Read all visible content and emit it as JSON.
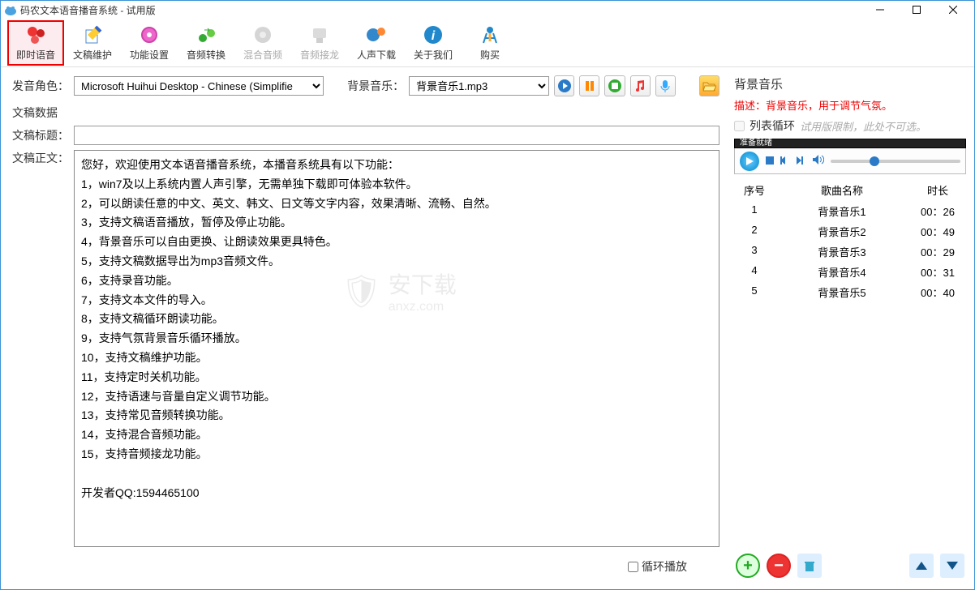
{
  "window": {
    "title": "码农文本语音播音系统 - 试用版"
  },
  "toolbar": {
    "items": [
      {
        "label": "即时语音",
        "icon": "gears-icon",
        "active": true
      },
      {
        "label": "文稿维护",
        "icon": "edit-doc-icon"
      },
      {
        "label": "功能设置",
        "icon": "gear-icon"
      },
      {
        "label": "音频转换",
        "icon": "convert-icon"
      },
      {
        "label": "混合音频",
        "icon": "mix-icon",
        "disabled": true
      },
      {
        "label": "音频接龙",
        "icon": "chain-icon",
        "disabled": true
      },
      {
        "label": "人声下载",
        "icon": "download-icon"
      },
      {
        "label": "关于我们",
        "icon": "info-icon"
      },
      {
        "label": "购买",
        "icon": "buy-icon"
      }
    ]
  },
  "voice": {
    "label": "发音角色：",
    "selected": "Microsoft Huihui Desktop - Chinese (Simplifie"
  },
  "bgm_row": {
    "label": "背景音乐：",
    "selected": "背景音乐1.mp3"
  },
  "data_section": {
    "header": "文稿数据",
    "title_label": "文稿标题：",
    "title_value": "",
    "body_label": "文稿正文：",
    "body_value": "您好，欢迎使用文本语音播音系统，本播音系统具有以下功能：\n1，win7及以上系统内置人声引擎，无需单独下载即可体验本软件。\n2，可以朗读任意的中文、英文、韩文、日文等文字内容，效果清晰、流畅、自然。\n3，支持文稿语音播放，暂停及停止功能。\n4，背景音乐可以自由更换、让朗读效果更具特色。\n5，支持文稿数据导出为mp3音频文件。\n6，支持录音功能。\n7，支持文本文件的导入。\n8，支持文稿循环朗读功能。\n9，支持气氛背景音乐循环播放。\n10，支持文稿维护功能。\n11，支持定时关机功能。\n12，支持语速与音量自定义调节功能。\n13，支持常见音频转换功能。\n14，支持混合音频功能。\n15，支持音频接龙功能。\n\n开发者QQ:1594465100",
    "loop_label": "循环播放"
  },
  "right": {
    "title": "背景音乐",
    "desc": "描述：背景音乐，用于调节气氛。",
    "loop_label": "列表循环",
    "loop_disabled_hint": "试用版限制，此处不可选。",
    "player_status": "准备就绪",
    "columns": {
      "num": "序号",
      "name": "歌曲名称",
      "dur": "时长"
    },
    "tracks": [
      {
        "num": "1",
        "name": "背景音乐1",
        "dur": "00：26"
      },
      {
        "num": "2",
        "name": "背景音乐2",
        "dur": "00：49"
      },
      {
        "num": "3",
        "name": "背景音乐3",
        "dur": "00：29"
      },
      {
        "num": "4",
        "name": "背景音乐4",
        "dur": "00：31"
      },
      {
        "num": "5",
        "name": "背景音乐5",
        "dur": "00：40"
      }
    ]
  },
  "watermark": {
    "main": "安下载",
    "sub": "anxz.com"
  }
}
